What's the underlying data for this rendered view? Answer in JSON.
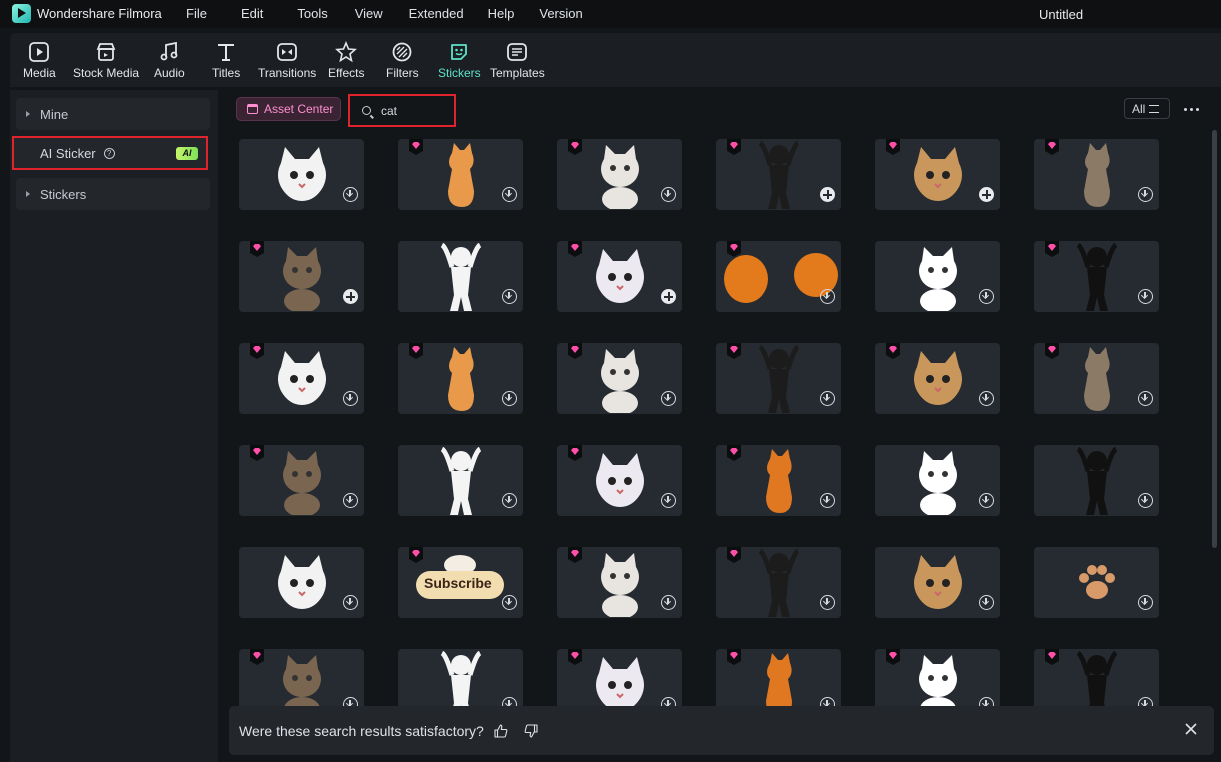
{
  "app": {
    "name": "Wondershare Filmora",
    "document_title": "Untitled"
  },
  "menu": [
    "File",
    "Edit",
    "Tools",
    "View",
    "Extended",
    "Help",
    "Version"
  ],
  "toolbar": {
    "active": "Stickers",
    "items": [
      {
        "label": "Media",
        "icon": "media-icon"
      },
      {
        "label": "Stock Media",
        "icon": "stock-media-icon"
      },
      {
        "label": "Audio",
        "icon": "audio-icon"
      },
      {
        "label": "Titles",
        "icon": "titles-icon"
      },
      {
        "label": "Transitions",
        "icon": "transitions-icon"
      },
      {
        "label": "Effects",
        "icon": "effects-icon"
      },
      {
        "label": "Filters",
        "icon": "filters-icon"
      },
      {
        "label": "Stickers",
        "icon": "stickers-icon"
      },
      {
        "label": "Templates",
        "icon": "templates-icon"
      }
    ]
  },
  "sidebar": {
    "mine": "Mine",
    "ai_sticker": "AI Sticker",
    "ai_badge": "AI",
    "stickers": "Stickers"
  },
  "main": {
    "asset_center": "Asset Center",
    "search": {
      "value": "cat",
      "placeholder": ""
    },
    "filter": "All"
  },
  "stickers": [
    {
      "name": "cat-selfie",
      "premium": false,
      "action": "download"
    },
    {
      "name": "cat-peeking",
      "premium": true,
      "action": "download"
    },
    {
      "name": "white-cat-face",
      "premium": true,
      "action": "download"
    },
    {
      "name": "dancing-tuxedo-cat",
      "premium": true,
      "action": "add"
    },
    {
      "name": "tabby-cat-tilt",
      "premium": true,
      "action": "add"
    },
    {
      "name": "grey-tabby-cat",
      "premium": true,
      "action": "download"
    },
    {
      "name": "screaming-cat",
      "premium": true,
      "action": "add"
    },
    {
      "name": "cartoon-cat-sitting",
      "premium": false,
      "action": "download"
    },
    {
      "name": "white-chubby-cat",
      "premium": true,
      "action": "add"
    },
    {
      "name": "orange-paws",
      "premium": true,
      "action": "download"
    },
    {
      "name": "white-cartoon-cat",
      "premium": false,
      "action": "download"
    },
    {
      "name": "tuxedo-cat-standing",
      "premium": true,
      "action": "download"
    },
    {
      "name": "cat-peek-cartoon",
      "premium": true,
      "action": "download"
    },
    {
      "name": "surprised-cat",
      "premium": true,
      "action": "download"
    },
    {
      "name": "tabby-cat-standing",
      "premium": true,
      "action": "download"
    },
    {
      "name": "orange-dancing-cat",
      "premium": true,
      "action": "download"
    },
    {
      "name": "grey-cat-dancing",
      "premium": true,
      "action": "download"
    },
    {
      "name": "orange-cat-sweater",
      "premium": true,
      "action": "download"
    },
    {
      "name": "calico-cat-dancing",
      "premium": true,
      "action": "download"
    },
    {
      "name": "grey-cartoon-cat-face",
      "premium": false,
      "action": "download"
    },
    {
      "name": "orange-cat-jumping",
      "premium": true,
      "action": "download"
    },
    {
      "name": "tabby-cat-face",
      "premium": true,
      "action": "download"
    },
    {
      "name": "tuxedo-cartoon-cat",
      "premium": false,
      "action": "download"
    },
    {
      "name": "white-cat-cartoon-sticker",
      "premium": false,
      "action": "download"
    },
    {
      "name": "black-cat",
      "premium": false,
      "action": "download"
    },
    {
      "name": "subscribe-cat",
      "premium": true,
      "action": "download",
      "text": "Subscribe"
    },
    {
      "name": "cartoon-cat-walking",
      "premium": true,
      "action": "download"
    },
    {
      "name": "tuxedo-cat-back",
      "premium": true,
      "action": "download"
    },
    {
      "name": "yellow-cartoon-cat",
      "premium": false,
      "action": "download"
    },
    {
      "name": "cat-paw-print",
      "premium": false,
      "action": "download"
    },
    {
      "name": "laser-eyes-cat",
      "premium": true,
      "action": "download"
    },
    {
      "name": "grey-tabby-cartoon",
      "premium": false,
      "action": "download"
    },
    {
      "name": "orange-cat-dance-2",
      "premium": true,
      "action": "download"
    },
    {
      "name": "tuxedo-cat-jumping",
      "premium": true,
      "action": "download"
    },
    {
      "name": "scottish-fold-cat",
      "premium": true,
      "action": "download"
    },
    {
      "name": "orange-cat-dance-3",
      "premium": true,
      "action": "download"
    }
  ],
  "feedback": {
    "question": "Were these search results satisfactory?"
  },
  "colors": {
    "accent": "#5fe3c8",
    "highlight_border": "#e0242e",
    "premium": "#ff4fa8",
    "ai_badge": "#a6ec63"
  }
}
